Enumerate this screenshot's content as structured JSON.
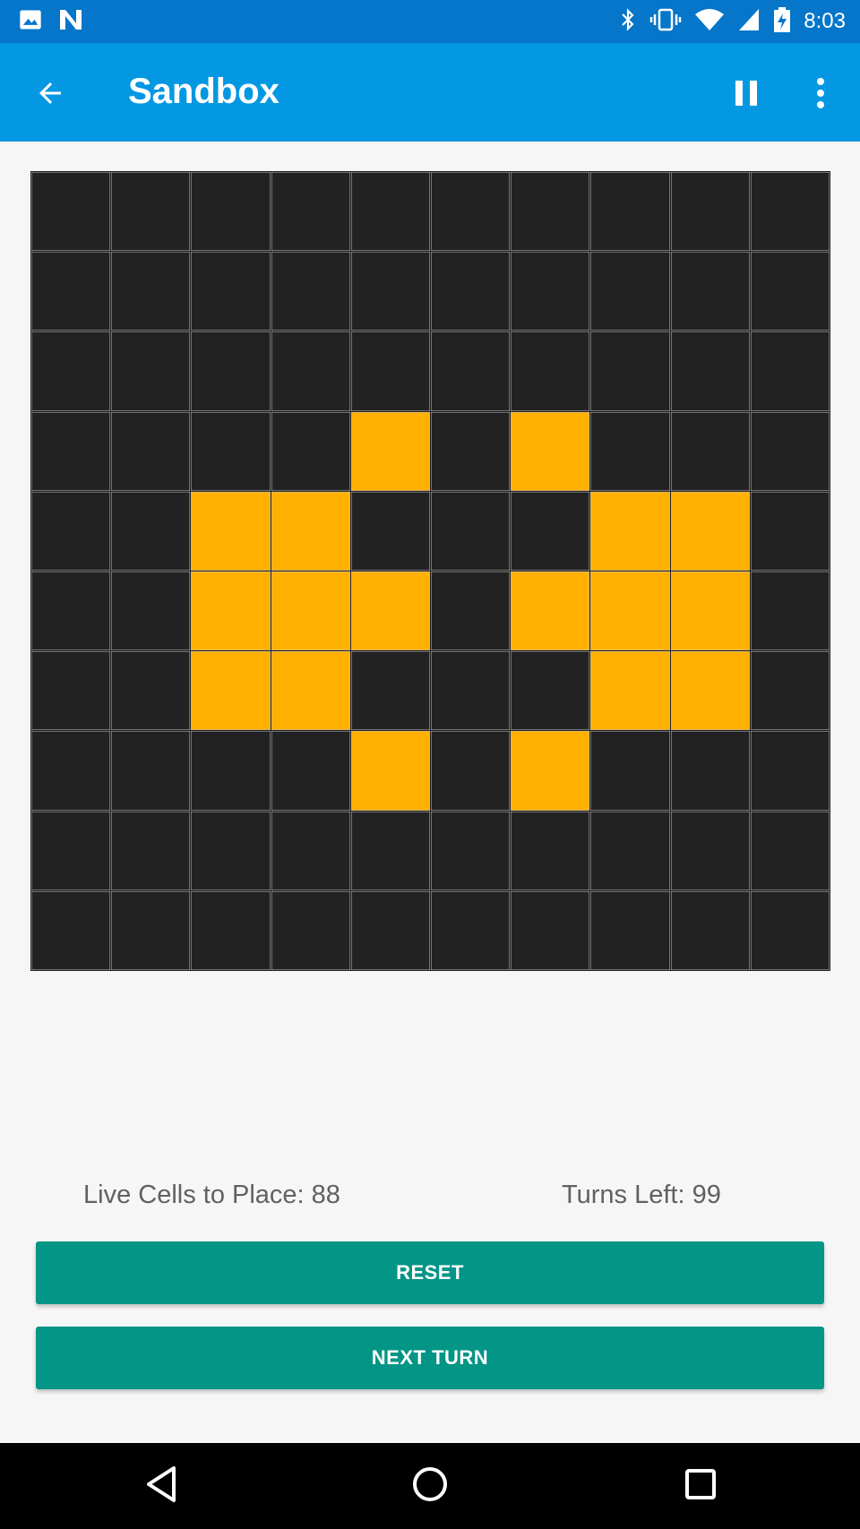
{
  "status_bar": {
    "time": "8:03",
    "left_icons": [
      "image-icon",
      "n-logo-icon"
    ],
    "right_icons": [
      "bluetooth-icon",
      "vibrate-icon",
      "wifi-icon",
      "signal-icon",
      "battery-charging-icon"
    ]
  },
  "app_bar": {
    "title": "Sandbox",
    "back_icon": "arrow-back-icon",
    "pause_icon": "pause-icon",
    "more_icon": "more-vert-icon"
  },
  "board": {
    "rows": 10,
    "cols": 10,
    "alive_color": "#ffb000",
    "dead_color": "#222222",
    "alive_cells": [
      [
        3,
        4
      ],
      [
        3,
        6
      ],
      [
        4,
        2
      ],
      [
        4,
        3
      ],
      [
        4,
        7
      ],
      [
        4,
        8
      ],
      [
        5,
        2
      ],
      [
        5,
        3
      ],
      [
        5,
        4
      ],
      [
        5,
        6
      ],
      [
        5,
        7
      ],
      [
        5,
        8
      ],
      [
        6,
        2
      ],
      [
        6,
        3
      ],
      [
        6,
        7
      ],
      [
        6,
        8
      ],
      [
        7,
        4
      ],
      [
        7,
        6
      ]
    ]
  },
  "stats": {
    "live_cells_text": "Live Cells to Place: 88",
    "turns_left_text": "Turns Left: 99"
  },
  "buttons": {
    "reset_label": "RESET",
    "next_turn_label": "NEXT TURN"
  },
  "colors": {
    "status_bar": "#0576c9",
    "app_bar": "#0498e3",
    "button": "#039585",
    "background": "#f7f6f6"
  },
  "nav_bar": {
    "icons": [
      "nav-back-icon",
      "nav-home-icon",
      "nav-recents-icon"
    ]
  }
}
